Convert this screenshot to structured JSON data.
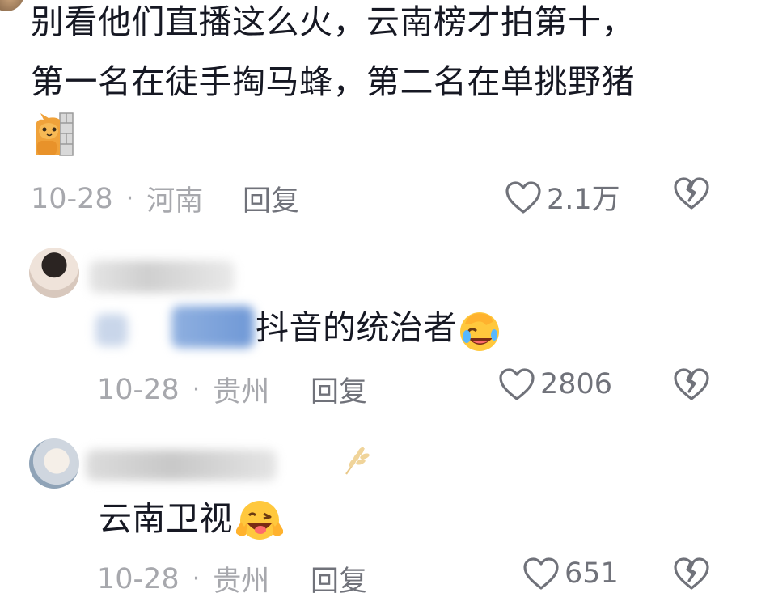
{
  "comment_main": {
    "lines": [
      "别看他们直播这么火，云南榜才拍第十，",
      "第一名在徒手掏马蜂，第二名在单挑野猪"
    ],
    "date": "10-28",
    "location": "河南",
    "reply_label": "回复",
    "like_count": "2.1万"
  },
  "reply_1": {
    "text": "抖音的统治者",
    "date": "10-28",
    "location": "贵州",
    "reply_label": "回复",
    "like_count": "2806"
  },
  "reply_2": {
    "text": "云南卫视",
    "date": "10-28",
    "location": "贵州",
    "reply_label": "回复",
    "like_count": "651"
  },
  "colors": {
    "text": "#161823",
    "meta": "#a7a8ad",
    "action": "#70727a",
    "background": "#ffffff"
  },
  "icons": [
    "cat-wall-emoji",
    "heart-icon",
    "broken-heart-icon",
    "facepalm-laugh-emoji",
    "wink-tongue-emoji",
    "wheat-icon"
  ]
}
